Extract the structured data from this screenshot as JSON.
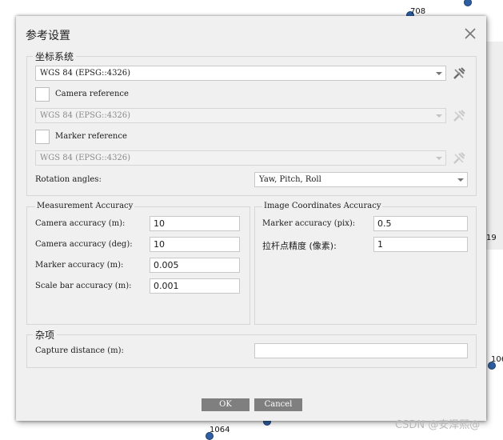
{
  "background": {
    "labels": [
      "708",
      "19",
      "106",
      "1064"
    ]
  },
  "dialog": {
    "title": "参考设置",
    "coordinate_system": {
      "legend": "坐标系统",
      "crs_value": "WGS 84 (EPSG::4326)",
      "camera_reference_label": "Camera reference",
      "camera_crs_value": "WGS 84 (EPSG::4326)",
      "marker_reference_label": "Marker reference",
      "marker_crs_value": "WGS 84 (EPSG::4326)",
      "rotation_label": "Rotation angles:",
      "rotation_value": "Yaw, Pitch, Roll"
    },
    "measurement": {
      "legend": "Measurement Accuracy",
      "camera_accuracy_m_label": "Camera accuracy (m):",
      "camera_accuracy_m": "10",
      "camera_accuracy_deg_label": "Camera accuracy (deg):",
      "camera_accuracy_deg": "10",
      "marker_accuracy_label": "Marker accuracy (m):",
      "marker_accuracy": "0.005",
      "scale_bar_label": "Scale bar accuracy (m):",
      "scale_bar_accuracy": "0.001"
    },
    "image_coords": {
      "legend": "Image Coordinates Accuracy",
      "marker_pix_label": "Marker accuracy (pix):",
      "marker_pix": "0.5",
      "tiepoint_label": "拉杆点精度 (像素):",
      "tiepoint": "1"
    },
    "misc": {
      "legend": "杂项",
      "capture_distance_label": "Capture distance (m):",
      "capture_distance": ""
    },
    "buttons": {
      "ok": "OK",
      "cancel": "Cancel"
    }
  },
  "watermark": "CSDN @安泽熙@",
  "colors": {
    "dialog_bg": "#f0f0f0",
    "button_bg": "#7f7f7f",
    "marker_dot": "#2f5fa0"
  }
}
